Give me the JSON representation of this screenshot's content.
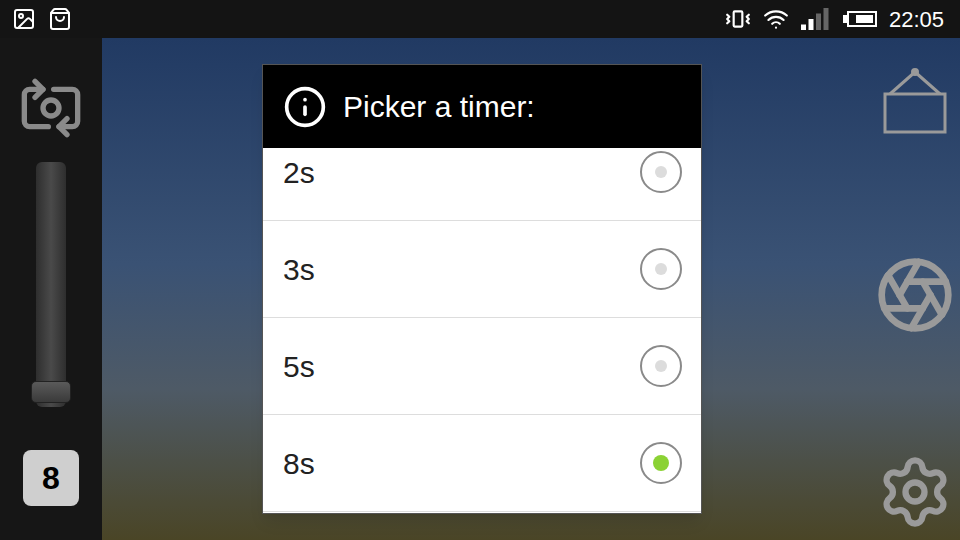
{
  "status_bar": {
    "time": "22:05",
    "signal": {
      "level": 0.5
    },
    "battery": {
      "level": 0.75
    }
  },
  "sidebar": {
    "zoom": {
      "level": 0.0
    },
    "timer_badge": "8"
  },
  "dialog": {
    "title": "Picker a timer:",
    "options": [
      {
        "label": "2s",
        "selected": false
      },
      {
        "label": "3s",
        "selected": false
      },
      {
        "label": "5s",
        "selected": false
      },
      {
        "label": "8s",
        "selected": true
      }
    ]
  }
}
